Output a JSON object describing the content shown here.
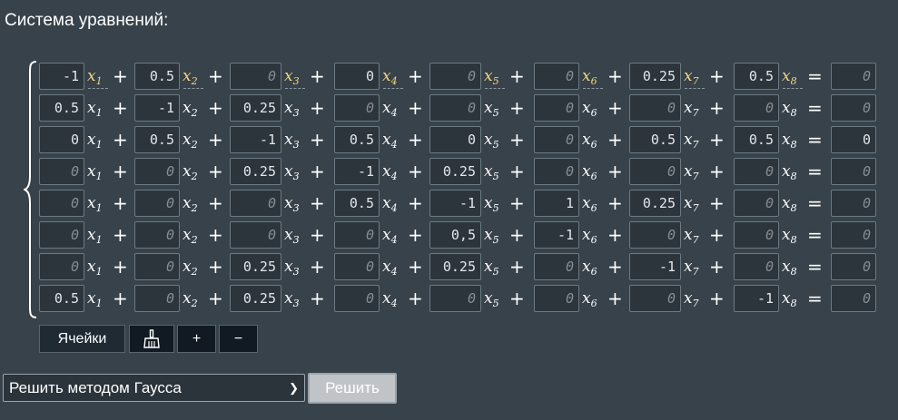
{
  "title": "Система уравнений:",
  "equals_sign": "=",
  "plus_sign": "+",
  "var_letter": "x",
  "subscripts": [
    "1",
    "2",
    "3",
    "4",
    "5",
    "6",
    "7",
    "8"
  ],
  "highlighted_row": 0,
  "rows": [
    {
      "coefs": [
        "-1",
        "0.5",
        "0",
        "0",
        "0",
        "0",
        "0.25",
        "0.5"
      ],
      "rhs": "0",
      "placeholder": [
        false,
        false,
        true,
        false,
        true,
        true,
        false,
        false
      ],
      "rhs_placeholder": true
    },
    {
      "coefs": [
        "0.5",
        "-1",
        "0.25",
        "0",
        "0",
        "0",
        "0",
        "0"
      ],
      "rhs": "0",
      "placeholder": [
        false,
        false,
        false,
        true,
        true,
        true,
        true,
        true
      ],
      "rhs_placeholder": true
    },
    {
      "coefs": [
        "0",
        "0.5",
        "-1",
        "0.5",
        "0",
        "0",
        "0.5",
        "0.5"
      ],
      "rhs": "0",
      "placeholder": [
        false,
        false,
        false,
        false,
        false,
        true,
        false,
        false
      ],
      "rhs_placeholder": false
    },
    {
      "coefs": [
        "0",
        "0",
        "0.25",
        "-1",
        "0.25",
        "0",
        "0",
        "0"
      ],
      "rhs": "0",
      "placeholder": [
        true,
        true,
        false,
        false,
        false,
        true,
        true,
        true
      ],
      "rhs_placeholder": true
    },
    {
      "coefs": [
        "0",
        "0",
        "0",
        "0.5",
        "-1",
        "1",
        "0.25",
        "0"
      ],
      "rhs": "0",
      "placeholder": [
        true,
        true,
        true,
        false,
        false,
        false,
        false,
        true
      ],
      "rhs_placeholder": true
    },
    {
      "coefs": [
        "0",
        "0",
        "0",
        "0",
        "0,5",
        "-1",
        "0",
        "0"
      ],
      "rhs": "0",
      "placeholder": [
        true,
        true,
        true,
        true,
        false,
        false,
        true,
        true
      ],
      "rhs_placeholder": true
    },
    {
      "coefs": [
        "0",
        "0",
        "0.25",
        "0",
        "0.25",
        "0",
        "-1",
        "0"
      ],
      "rhs": "0",
      "placeholder": [
        true,
        true,
        false,
        true,
        false,
        true,
        false,
        true
      ],
      "rhs_placeholder": true
    },
    {
      "coefs": [
        "0.5",
        "0",
        "0.25",
        "0",
        "0",
        "0",
        "0",
        "-1"
      ],
      "rhs": "0",
      "placeholder": [
        false,
        true,
        false,
        true,
        true,
        true,
        true,
        false
      ],
      "rhs_placeholder": true
    }
  ],
  "toolbar": {
    "cells_label": "Ячейки",
    "clear_icon": "broom-icon",
    "add_label": "+",
    "remove_label": "−"
  },
  "method": {
    "selected": "Решить методом Гаусса",
    "icon": "chevron-down-icon"
  },
  "solve_label": "Решить"
}
